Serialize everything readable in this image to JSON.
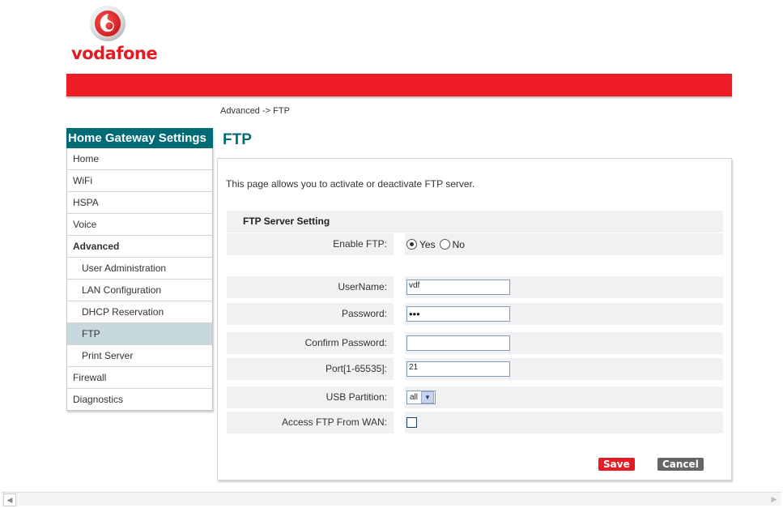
{
  "brand": {
    "name": "vodafone",
    "color": "#ee1c25"
  },
  "breadcrumb": "Advanced -> FTP",
  "sidebar": {
    "title": "Home Gateway Settings",
    "items": [
      {
        "label": "Home"
      },
      {
        "label": "WiFi"
      },
      {
        "label": "HSPA"
      },
      {
        "label": "Voice"
      },
      {
        "label": "Advanced"
      },
      {
        "label": "User Administration"
      },
      {
        "label": "LAN Configuration"
      },
      {
        "label": "DHCP Reservation"
      },
      {
        "label": "FTP"
      },
      {
        "label": "Print Server"
      },
      {
        "label": "Firewall"
      },
      {
        "label": "Diagnostics"
      }
    ],
    "active_item": "FTP"
  },
  "main": {
    "title": "FTP",
    "description": "This page allows you to activate or deactivate FTP server.",
    "section_title": "FTP Server Setting",
    "enable_ftp": {
      "label": "Enable FTP:",
      "yes_label": "Yes",
      "no_label": "No",
      "selected": "Yes"
    },
    "username": {
      "label": "UserName:",
      "value": "vdf"
    },
    "password": {
      "label": "Password:",
      "value": "•••"
    },
    "confirm_password": {
      "label": "Confirm Password:",
      "value": ""
    },
    "port": {
      "label": "Port[1-65535]:",
      "value": "21"
    },
    "usb_partition": {
      "label": "USB Partition:",
      "value": "all"
    },
    "access_wan": {
      "label": "Access FTP From WAN:",
      "checked": false
    },
    "buttons": {
      "save": "Save",
      "cancel": "Cancel"
    }
  },
  "colors": {
    "accent": "#006b74",
    "save": "#e81c24",
    "cancel": "#666666"
  }
}
